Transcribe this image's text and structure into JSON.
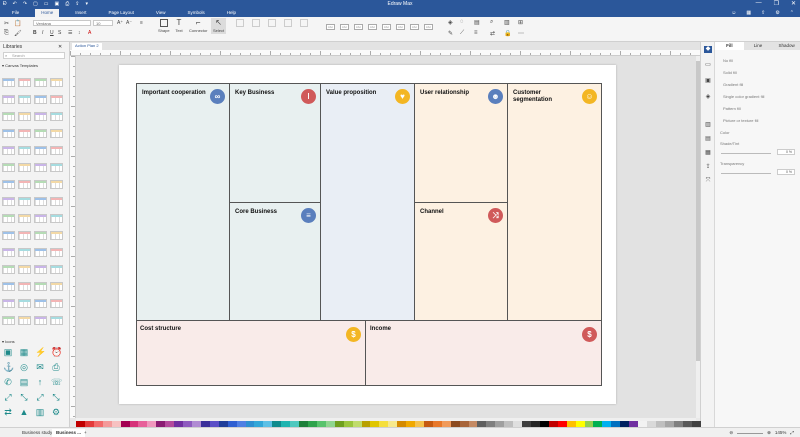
{
  "window": {
    "title": "Edraw Max",
    "controls": [
      "—",
      "❐",
      "✕"
    ]
  },
  "menu": {
    "tabs": [
      "File",
      "Home",
      "Insert",
      "Page Layout",
      "View",
      "Symbols",
      "Help"
    ],
    "active": "Home"
  },
  "ribbon": {
    "font_value": "Verdana",
    "size_value": "10",
    "tools": [
      "Shape",
      "Text",
      "Connector",
      "Select"
    ],
    "style_swatch_label": "Abc"
  },
  "left_panel": {
    "title": "Libraries",
    "search_placeholder": "Search",
    "section_templates": "Canvas Templates",
    "section_icons": "Icons"
  },
  "document": {
    "tab_label": "Action Plan 2"
  },
  "canvas": {
    "cells": [
      {
        "label": "Important cooperation",
        "icon": "handshake-icon",
        "color": "#5a7fbd",
        "glyph": "∞"
      },
      {
        "label": "Key Business",
        "icon": "thermometer-icon",
        "color": "#d05a5a",
        "glyph": "🌡"
      },
      {
        "label": "Value proposition",
        "icon": "gift-icon",
        "color": "#f3b623",
        "glyph": "♥"
      },
      {
        "label": "User relationship",
        "icon": "users-icon",
        "color": "#5a7fbd",
        "glyph": "👥"
      },
      {
        "label": "Customer segmentation",
        "icon": "person-icon",
        "color": "#f3b623",
        "glyph": "☺"
      },
      {
        "label": "Core Business",
        "icon": "document-icon",
        "color": "#5a7fbd",
        "glyph": "≡"
      },
      {
        "label": "Channel",
        "icon": "shuffle-icon",
        "color": "#d05a5a",
        "glyph": "⤨"
      },
      {
        "label": "Cost structure",
        "icon": "dollar-icon",
        "color": "#f3b623",
        "glyph": "$"
      },
      {
        "label": "Income",
        "icon": "money-bag-icon",
        "color": "#d05a5a",
        "glyph": "$"
      }
    ],
    "fills": {
      "blue": "#e8f0f0",
      "grayblue": "#e9eef5",
      "peach": "#fdf1e2",
      "pink": "#f9ebe9"
    }
  },
  "right_panel": {
    "tabs": [
      "Fill",
      "Line",
      "Shadow"
    ],
    "active_tab": "Fill",
    "options": [
      "No fill",
      "Solid fill",
      "Gradient fill",
      "Single color gradient fill",
      "Pattern fill",
      "Picture or texture fill"
    ],
    "color_label": "Color",
    "shade_label": "Shade/Tint",
    "shade_value": "0 %",
    "transparency_label": "Transparency",
    "transparency_value": "0 %"
  },
  "status": {
    "page1": "Business study",
    "page2": "Business ...",
    "add_page": "+",
    "zoom": "145%"
  },
  "palette": [
    "#c00000",
    "#e33b3b",
    "#f26b6b",
    "#f49a9a",
    "#f7c1c1",
    "#a30052",
    "#d6337a",
    "#e7609a",
    "#f097bd",
    "#8a1c72",
    "#b44a9c",
    "#7030a0",
    "#8e5bbf",
    "#b08bd3",
    "#3b2f9a",
    "#5b4fc7",
    "#1f3d9a",
    "#2f5fd1",
    "#4f7fe3",
    "#2f8fd1",
    "#33a7d8",
    "#5cc0e6",
    "#0f8b8d",
    "#1fb4b0",
    "#4fc9bf",
    "#1d7f3a",
    "#2fa34c",
    "#58c36c",
    "#8fd68f",
    "#6f9f1f",
    "#9bc53d",
    "#c0dc6b",
    "#b8a000",
    "#e0c600",
    "#f5df3d",
    "#f7e98c",
    "#d48a00",
    "#f0a800",
    "#f6c24d",
    "#c55a11",
    "#e8782a",
    "#f19a5a",
    "#8c4a1f",
    "#a8653a",
    "#c58a63",
    "#5f5f5f",
    "#7f7f7f",
    "#9f9f9f",
    "#bfbfbf",
    "#dfdfdf",
    "#3f3f3f",
    "#262626",
    "#000000",
    "#c00000",
    "#ff0000",
    "#ffc000",
    "#ffff00",
    "#92d050",
    "#00b050",
    "#00b0f0",
    "#0070c0",
    "#002060",
    "#7030a0",
    "#f2f2f2",
    "#d9d9d9",
    "#bfbfbf",
    "#a6a6a6",
    "#808080",
    "#595959",
    "#404040"
  ]
}
